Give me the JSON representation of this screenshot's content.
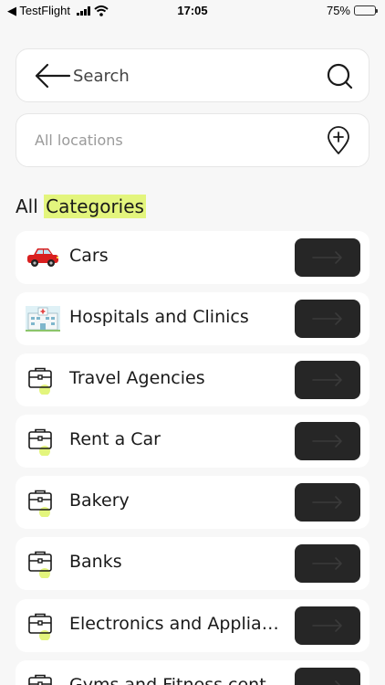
{
  "status_bar": {
    "back_app": "◀ TestFlight",
    "time": "17:05",
    "battery": "75%",
    "battery_level": 0.75
  },
  "search": {
    "label": "Search"
  },
  "location": {
    "placeholder": "All locations"
  },
  "heading": {
    "prefix": "All ",
    "highlight": "Categories",
    "highlight_color": "#e3f57d"
  },
  "categories": [
    {
      "label": "Cars",
      "icon": "car-icon"
    },
    {
      "label": "Hospitals and Clinics",
      "icon": "hospital-icon"
    },
    {
      "label": "Travel Agencies",
      "icon": "briefcase-icon"
    },
    {
      "label": "Rent a Car",
      "icon": "briefcase-icon"
    },
    {
      "label": "Bakery",
      "icon": "briefcase-icon"
    },
    {
      "label": "Banks",
      "icon": "briefcase-icon"
    },
    {
      "label": "Electronics and Appliances",
      "icon": "briefcase-icon"
    },
    {
      "label": "Gyms and Fitness cent",
      "icon": "briefcase-icon"
    }
  ],
  "colors": {
    "background": "#f7f7f7",
    "button": "#262626",
    "accent": "#e3f57d"
  }
}
